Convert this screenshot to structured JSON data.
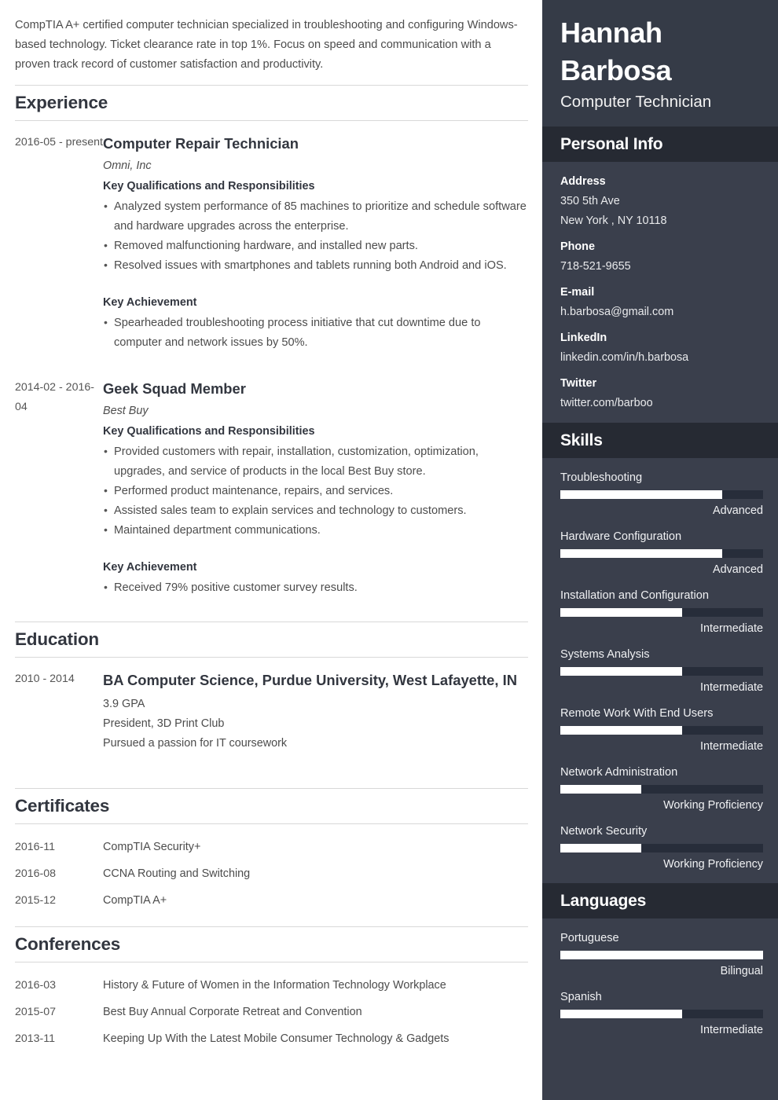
{
  "main": {
    "summary": "CompTIA A+ certified computer technician specialized in troubleshooting and configuring Windows-based technology. Ticket clearance rate in top 1%. Focus on speed and communication with a proven track record of customer satisfaction and productivity.",
    "sections": {
      "experience": {
        "title": "Experience",
        "jobs": [
          {
            "date": "2016-05 - present",
            "title": "Computer Repair Technician",
            "company": "Omni, Inc",
            "qualifications_label": "Key Qualifications and Responsibilities",
            "qualifications": [
              "Analyzed system performance of 85 machines to prioritize and schedule software and hardware upgrades across the enterprise.",
              "Removed malfunctioning hardware, and installed new parts.",
              "Resolved issues with smartphones and tablets running both Android and iOS."
            ],
            "achievement_label": "Key Achievement",
            "achievements": [
              "Spearheaded troubleshooting process initiative that cut downtime due to computer and network issues by 50%."
            ]
          },
          {
            "date": "2014-02 - 2016-04",
            "title": "Geek Squad Member",
            "company": "Best Buy",
            "qualifications_label": "Key Qualifications and Responsibilities",
            "qualifications": [
              "Provided customers with repair, installation, customization, optimization, upgrades, and service of products in the local Best Buy store.",
              "Performed product maintenance, repairs, and services.",
              "Assisted sales team to explain services and technology to customers.",
              "Maintained department communications."
            ],
            "achievement_label": "Key Achievement",
            "achievements": [
              "Received 79% positive customer survey results."
            ]
          }
        ]
      },
      "education": {
        "title": "Education",
        "entries": [
          {
            "date": "2010 - 2014",
            "degree": "BA Computer Science, Purdue University, West Lafayette, IN",
            "details": [
              "3.9 GPA",
              "President, 3D Print Club",
              "Pursued a passion for IT coursework"
            ]
          }
        ]
      },
      "certificates": {
        "title": "Certificates",
        "rows": [
          {
            "date": "2016-11",
            "text": "CompTIA Security+"
          },
          {
            "date": "2016-08",
            "text": "CCNA Routing and Switching"
          },
          {
            "date": "2015-12",
            "text": "CompTIA A+"
          }
        ]
      },
      "conferences": {
        "title": "Conferences",
        "rows": [
          {
            "date": "2016-03",
            "text": "History & Future of Women in the Information Technology Workplace"
          },
          {
            "date": "2015-07",
            "text": "Best Buy Annual Corporate Retreat and Convention"
          },
          {
            "date": "2013-11",
            "text": "Keeping Up With the Latest Mobile Consumer Technology & Gadgets"
          }
        ]
      }
    }
  },
  "sidebar": {
    "name_first": "Hannah",
    "name_last": "Barbosa",
    "role": "Computer Technician",
    "personal_info": {
      "title": "Personal Info",
      "groups": [
        {
          "label": "Address",
          "values": [
            "350 5th Ave",
            "New York , NY 10118"
          ]
        },
        {
          "label": "Phone",
          "values": [
            "718-521-9655"
          ]
        },
        {
          "label": "E-mail",
          "values": [
            "h.barbosa@gmail.com"
          ]
        },
        {
          "label": "LinkedIn",
          "values": [
            "linkedin.com/in/h.barbosa"
          ]
        },
        {
          "label": "Twitter",
          "values": [
            "twitter.com/barboo"
          ]
        }
      ]
    },
    "skills": {
      "title": "Skills",
      "items": [
        {
          "name": "Troubleshooting",
          "level": "Advanced",
          "percent": 80
        },
        {
          "name": "Hardware Configuration",
          "level": "Advanced",
          "percent": 80
        },
        {
          "name": "Installation and Configuration",
          "level": "Intermediate",
          "percent": 60
        },
        {
          "name": "Systems Analysis",
          "level": "Intermediate",
          "percent": 60
        },
        {
          "name": "Remote Work With End Users",
          "level": "Intermediate",
          "percent": 60
        },
        {
          "name": "Network Administration",
          "level": "Working Proficiency",
          "percent": 40
        },
        {
          "name": "Network Security",
          "level": "Working Proficiency",
          "percent": 40
        }
      ]
    },
    "languages": {
      "title": "Languages",
      "items": [
        {
          "name": "Portuguese",
          "level": "Bilingual",
          "percent": 100
        },
        {
          "name": "Spanish",
          "level": "Intermediate",
          "percent": 60
        }
      ]
    }
  },
  "colors": {
    "sidebar_bg": "#3a3f4c",
    "sidebar_header_bg": "#353b47",
    "section_bar_bg": "#262a33",
    "bar_track": "#272d3a",
    "bar_fill": "#ffffff",
    "heading_text": "#32363f",
    "body_text": "#4c4c4c",
    "divider": "#d8d8d8"
  }
}
